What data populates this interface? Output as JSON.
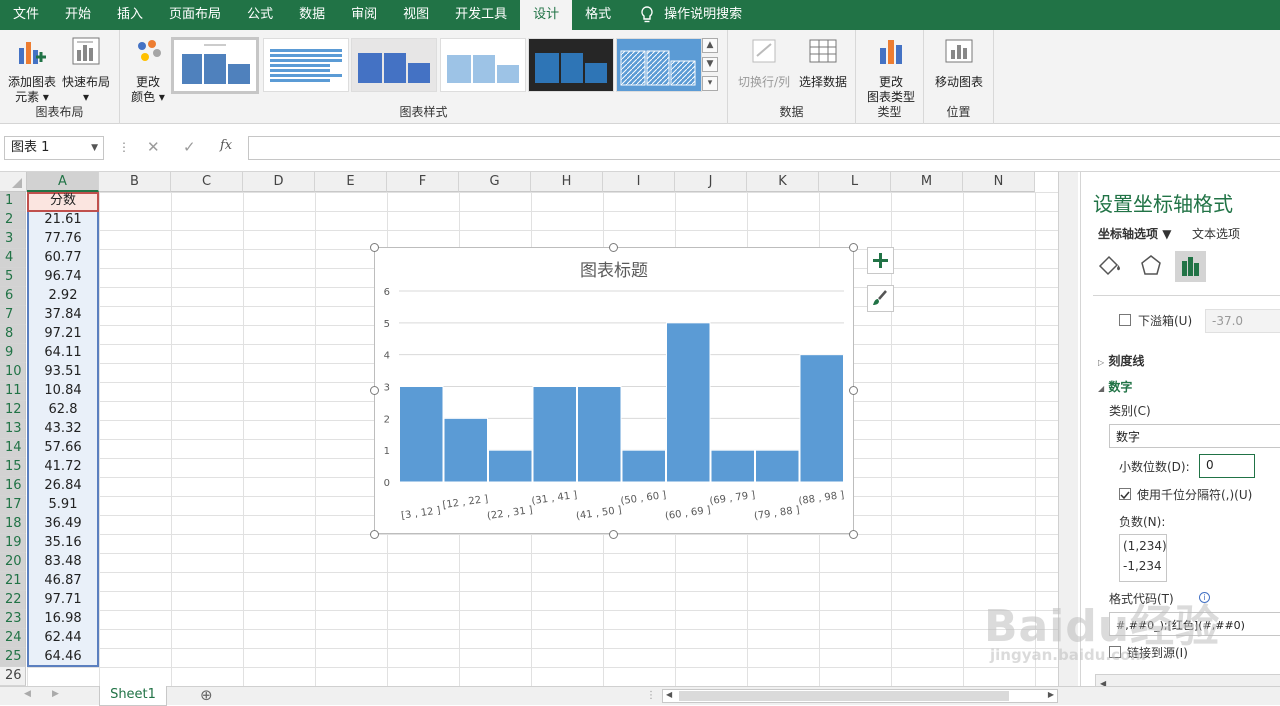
{
  "menubar": {
    "tabs": [
      "文件",
      "开始",
      "插入",
      "页面布局",
      "公式",
      "数据",
      "审阅",
      "视图",
      "开发工具",
      "设计",
      "格式"
    ],
    "active_tab": "设计",
    "tell_me": "操作说明搜索"
  },
  "ribbon": {
    "groups": {
      "chart_layouts": "图表布局",
      "chart_styles": "图表样式",
      "data": "数据",
      "type": "类型",
      "location": "位置"
    },
    "buttons": {
      "add_element_1": "添加图表",
      "add_element_2": "元素",
      "quick_layout": "快速布局",
      "change_colors_1": "更改",
      "change_colors_2": "颜色",
      "switch_row_col": "切换行/列",
      "select_data": "选择数据",
      "change_type_1": "更改",
      "change_type_2": "图表类型",
      "move_chart": "移动图表"
    }
  },
  "formula_bar": {
    "name_box": "图表 1",
    "cancel_icon": "✕",
    "enter_icon": "✓",
    "fx_label": "fx",
    "formula": ""
  },
  "columns": [
    "A",
    "B",
    "C",
    "D",
    "E",
    "F",
    "G",
    "H",
    "I",
    "J",
    "K",
    "L",
    "M",
    "N"
  ],
  "rows": [
    "1",
    "2",
    "3",
    "4",
    "5",
    "6",
    "7",
    "8",
    "9",
    "10",
    "11",
    "12",
    "13",
    "14",
    "15",
    "16",
    "17",
    "18",
    "19",
    "20",
    "21",
    "22",
    "23",
    "24",
    "25",
    "26"
  ],
  "column_a": [
    "分数",
    "21.61",
    "77.76",
    "60.77",
    "96.74",
    "2.92",
    "37.84",
    "97.21",
    "64.11",
    "93.51",
    "10.84",
    "62.8",
    "43.32",
    "57.66",
    "41.72",
    "26.84",
    "5.91",
    "36.49",
    "35.16",
    "83.48",
    "46.87",
    "97.71",
    "16.98",
    "62.44",
    "64.46",
    ""
  ],
  "chart": {
    "title": "图表标题"
  },
  "chart_data": {
    "type": "bar",
    "title": "图表标题",
    "categories": [
      "[3 , 12 ]",
      "[12 , 22 ]",
      "(22 , 31 ]",
      "(31 , 41 ]",
      "(41 , 50 ]",
      "(50 , 60 ]",
      "(60 , 69 ]",
      "(69 , 79 ]",
      "(79 , 88 ]",
      "(88 , 98 ]"
    ],
    "values": [
      3,
      2,
      1,
      3,
      3,
      1,
      5,
      1,
      1,
      4
    ],
    "ylim": [
      0,
      6
    ],
    "yticks": [
      0,
      1,
      2,
      3,
      4,
      5,
      6
    ],
    "grid": true,
    "color": "#5b9bd5"
  },
  "pane": {
    "title": "设置坐标轴格式",
    "tab_axis_options": "坐标轴选项",
    "tab_text_options": "文本选项",
    "underflow_label": "下溢箱(U)",
    "underflow_value": "-37.0",
    "tick_marks": "刻度线",
    "number": "数字",
    "category_label": "类别(C)",
    "category_value": "数字",
    "decimal_label": "小数位数(D):",
    "decimal_value": "0",
    "thousands_label": "使用千位分隔符(,)(U)",
    "negative_label": "负数(N):",
    "negative_opt1": "(1,234)",
    "negative_opt2": "-1,234",
    "format_code_label": "格式代码(T)",
    "format_code_value": "#,##0_);[红色](#,##0)",
    "link_source_label": "链接到源(I)"
  },
  "sheet_tab": "Sheet1",
  "add_sheet": "⊕",
  "watermark": {
    "logo": "Baidu经验",
    "url": "jingyan.baidu.com"
  },
  "colors": {
    "accent": "#217346",
    "bar": "#5b9bd5",
    "selected_cells_bg": "#e9f0f9"
  }
}
